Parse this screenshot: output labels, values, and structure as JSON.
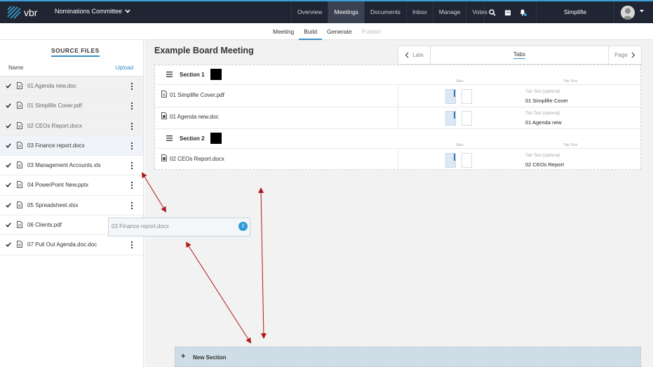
{
  "topbar": {
    "logo_text": "vbr",
    "committee": "Nominations Committee",
    "nav": [
      "Overview",
      "Meetings",
      "Documents",
      "Inbox",
      "Manage",
      "Votes"
    ],
    "active_nav": "Meetings",
    "icons": [
      "search-icon",
      "calendar-icon",
      "bell-icon"
    ],
    "user": "Simplifie"
  },
  "subnav": {
    "tabs": [
      "Meeting",
      "Build",
      "Generate",
      "Publish"
    ],
    "active": "Build",
    "disabled": "Publish"
  },
  "sidebar": {
    "title": "SOURCE FILES",
    "col_name": "Name",
    "upload": "Upload",
    "files": [
      {
        "name": "01 Agenda new.doc",
        "state": "used"
      },
      {
        "name": "01 Simplifie Cover.pdf",
        "state": "used"
      },
      {
        "name": "02 CEOs Report.docx",
        "state": "used"
      },
      {
        "name": "03 Finance report.docx",
        "state": "dragging"
      },
      {
        "name": "03 Management Accounts.xls",
        "state": "normal"
      },
      {
        "name": "04 PowerPoint New.pptx",
        "state": "normal"
      },
      {
        "name": "05 Spreadsheet.xlsx",
        "state": "normal"
      },
      {
        "name": "06 Clients.pdf",
        "state": "normal"
      },
      {
        "name": "07 Pull Out Agenda.doc.doc",
        "state": "normal"
      }
    ]
  },
  "main": {
    "title": "Example Board Meeting",
    "pager": {
      "prev": "Late",
      "current": "Tabs",
      "next": "Page"
    },
    "tabs_header": "Tabs",
    "tab_text_header": "Tab Text",
    "tab_text_hint": "Tab Text (optional)",
    "sections": [
      {
        "name": "Section 1",
        "items": [
          {
            "name": "01 Simplifie Cover.pdf",
            "tab_text": "01 Simplifie Cover"
          },
          {
            "name": "01 Agenda new.doc",
            "tab_text": "01 Agenda new"
          }
        ]
      },
      {
        "name": "Section 2",
        "items": [
          {
            "name": "02 CEOs Report.docx",
            "tab_text": "02 CEOs Report"
          }
        ]
      }
    ],
    "new_section": "New Section"
  },
  "drag": {
    "label": "03 Finance report.docx",
    "count": "2"
  },
  "colors": {
    "topbar": "#1f2532",
    "accent": "#3a8fc4",
    "badge": "#2f9ad6",
    "annotation_arrow": "#b01818",
    "new_section_bg": "#cfdde6"
  }
}
